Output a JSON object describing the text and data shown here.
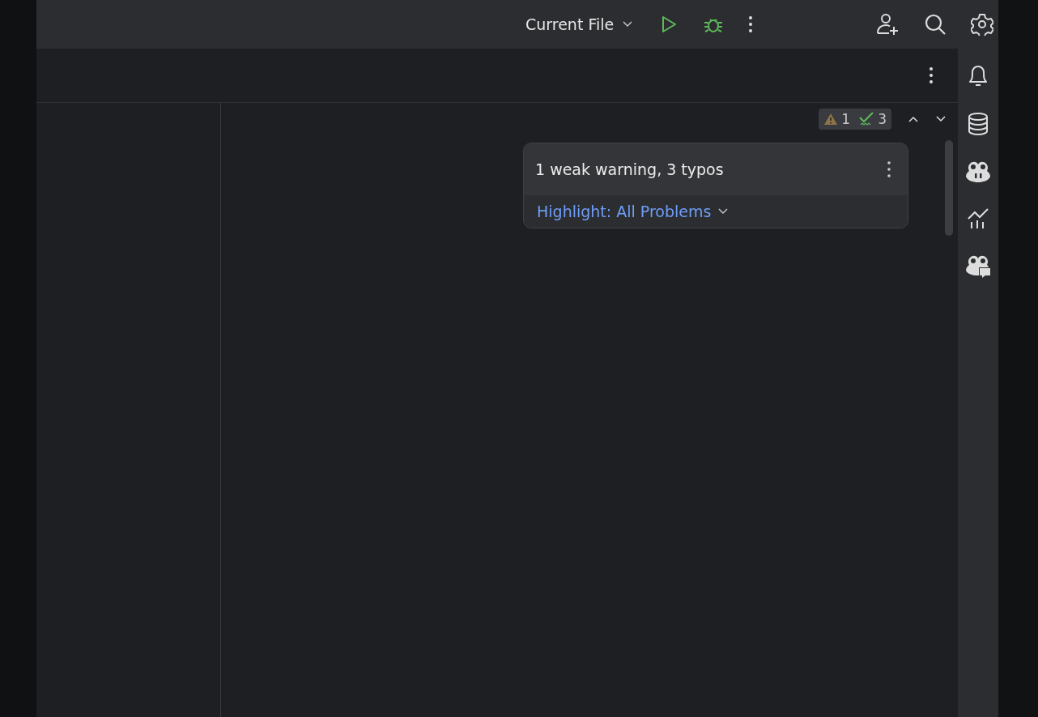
{
  "toolbar": {
    "run_configuration": "Current File"
  },
  "inspection_widget": {
    "warnings": "1",
    "typos": "3"
  },
  "inspection_popup": {
    "title": "1 weak warning, 3 typos",
    "highlight_link": "Highlight: All Problems"
  }
}
